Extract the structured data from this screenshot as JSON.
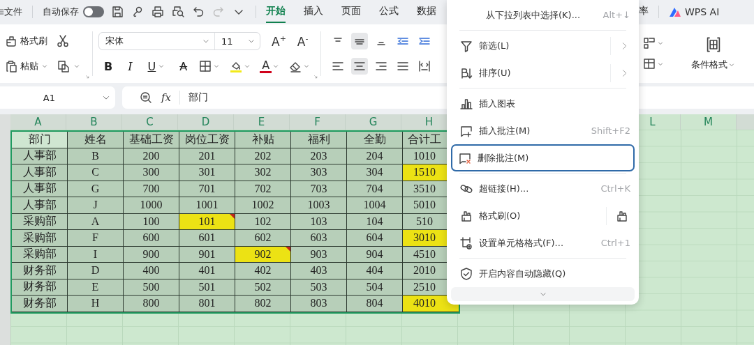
{
  "topbar": {
    "file_menu": "文件",
    "autosave": {
      "label": "自动保存",
      "on": false
    },
    "tabs": [
      {
        "label": "开始",
        "selected": true
      },
      {
        "label": "插入",
        "selected": false
      },
      {
        "label": "页面",
        "selected": false
      },
      {
        "label": "公式",
        "selected": false
      },
      {
        "label": "数据",
        "selected": false
      }
    ],
    "right_tab": "率",
    "ai_button": "WPS AI"
  },
  "ribbon": {
    "format_painter": "格式刷",
    "paste": "粘贴",
    "font_name": "宋体",
    "font_size": "11",
    "grow_font": "A$^{+}$",
    "shrink_font": "A$^{-}$",
    "format_buttons": [
      {
        "kind": "bold",
        "label": "B"
      },
      {
        "kind": "italic",
        "label": "I"
      },
      {
        "kind": "underline",
        "label": "U"
      },
      {
        "kind": "strike",
        "label": "A"
      }
    ],
    "font_color": "A",
    "conditional_format": "条件格式"
  },
  "formula_bar": {
    "cell_ref": "A1",
    "function_label": "fx",
    "value": "部门"
  },
  "sheet": {
    "columns": [
      "A",
      "B",
      "C",
      "D",
      "E",
      "F",
      "G",
      "H"
    ],
    "columns_right": [
      "L",
      "M"
    ],
    "rows": [
      [
        {
          "text": "部门",
          "highlighted": false,
          "comment": false,
          "selected": true
        },
        {
          "text": "姓名",
          "highlighted": false,
          "comment": false,
          "selected": false
        },
        {
          "text": "基础工资",
          "highlighted": false,
          "comment": false,
          "selected": false
        },
        {
          "text": "岗位工资",
          "highlighted": false,
          "comment": false,
          "selected": false
        },
        {
          "text": "补贴",
          "highlighted": false,
          "comment": false,
          "selected": false
        },
        {
          "text": "福利",
          "highlighted": false,
          "comment": false,
          "selected": false
        },
        {
          "text": "全勤",
          "highlighted": false,
          "comment": false,
          "selected": false
        },
        {
          "text": "合计工",
          "highlighted": false,
          "comment": false,
          "selected": false
        }
      ],
      [
        {
          "text": "人事部",
          "highlighted": false,
          "comment": false,
          "selected": false
        },
        {
          "text": "B",
          "highlighted": false,
          "comment": false,
          "selected": false
        },
        {
          "text": "200",
          "highlighted": false,
          "comment": false,
          "selected": false
        },
        {
          "text": "201",
          "highlighted": false,
          "comment": false,
          "selected": false
        },
        {
          "text": "202",
          "highlighted": false,
          "comment": false,
          "selected": false
        },
        {
          "text": "203",
          "highlighted": false,
          "comment": false,
          "selected": false
        },
        {
          "text": "204",
          "highlighted": false,
          "comment": false,
          "selected": false
        },
        {
          "text": "1010",
          "highlighted": false,
          "comment": false,
          "selected": false
        }
      ],
      [
        {
          "text": "人事部",
          "highlighted": false,
          "comment": false,
          "selected": false
        },
        {
          "text": "C",
          "highlighted": false,
          "comment": false,
          "selected": false
        },
        {
          "text": "300",
          "highlighted": false,
          "comment": false,
          "selected": false
        },
        {
          "text": "301",
          "highlighted": false,
          "comment": false,
          "selected": false
        },
        {
          "text": "302",
          "highlighted": false,
          "comment": false,
          "selected": false
        },
        {
          "text": "303",
          "highlighted": false,
          "comment": false,
          "selected": false
        },
        {
          "text": "304",
          "highlighted": false,
          "comment": false,
          "selected": false
        },
        {
          "text": "1510",
          "highlighted": true,
          "comment": false,
          "selected": false
        }
      ],
      [
        {
          "text": "人事部",
          "highlighted": false,
          "comment": false,
          "selected": false
        },
        {
          "text": "G",
          "highlighted": false,
          "comment": false,
          "selected": false
        },
        {
          "text": "700",
          "highlighted": false,
          "comment": false,
          "selected": false
        },
        {
          "text": "701",
          "highlighted": false,
          "comment": false,
          "selected": false
        },
        {
          "text": "702",
          "highlighted": false,
          "comment": false,
          "selected": false
        },
        {
          "text": "703",
          "highlighted": false,
          "comment": false,
          "selected": false
        },
        {
          "text": "704",
          "highlighted": false,
          "comment": false,
          "selected": false
        },
        {
          "text": "3510",
          "highlighted": false,
          "comment": false,
          "selected": false
        }
      ],
      [
        {
          "text": "人事部",
          "highlighted": false,
          "comment": false,
          "selected": false
        },
        {
          "text": "J",
          "highlighted": false,
          "comment": false,
          "selected": false
        },
        {
          "text": "1000",
          "highlighted": false,
          "comment": false,
          "selected": false
        },
        {
          "text": "1001",
          "highlighted": false,
          "comment": false,
          "selected": false
        },
        {
          "text": "1002",
          "highlighted": false,
          "comment": false,
          "selected": false
        },
        {
          "text": "1003",
          "highlighted": false,
          "comment": false,
          "selected": false
        },
        {
          "text": "1004",
          "highlighted": false,
          "comment": false,
          "selected": false
        },
        {
          "text": "5010",
          "highlighted": false,
          "comment": false,
          "selected": false
        }
      ],
      [
        {
          "text": "采购部",
          "highlighted": false,
          "comment": false,
          "selected": false
        },
        {
          "text": "A",
          "highlighted": false,
          "comment": false,
          "selected": false
        },
        {
          "text": "100",
          "highlighted": false,
          "comment": false,
          "selected": false
        },
        {
          "text": "101",
          "highlighted": true,
          "comment": true,
          "selected": false
        },
        {
          "text": "102",
          "highlighted": false,
          "comment": false,
          "selected": false
        },
        {
          "text": "103",
          "highlighted": false,
          "comment": false,
          "selected": false
        },
        {
          "text": "104",
          "highlighted": false,
          "comment": false,
          "selected": false
        },
        {
          "text": "510",
          "highlighted": false,
          "comment": false,
          "selected": false
        }
      ],
      [
        {
          "text": "采购部",
          "highlighted": false,
          "comment": false,
          "selected": false
        },
        {
          "text": "F",
          "highlighted": false,
          "comment": false,
          "selected": false
        },
        {
          "text": "600",
          "highlighted": false,
          "comment": false,
          "selected": false
        },
        {
          "text": "601",
          "highlighted": false,
          "comment": false,
          "selected": false
        },
        {
          "text": "602",
          "highlighted": false,
          "comment": false,
          "selected": false
        },
        {
          "text": "603",
          "highlighted": false,
          "comment": false,
          "selected": false
        },
        {
          "text": "604",
          "highlighted": false,
          "comment": false,
          "selected": false
        },
        {
          "text": "3010",
          "highlighted": true,
          "comment": false,
          "selected": false
        }
      ],
      [
        {
          "text": "采购部",
          "highlighted": false,
          "comment": false,
          "selected": false
        },
        {
          "text": "I",
          "highlighted": false,
          "comment": false,
          "selected": false
        },
        {
          "text": "900",
          "highlighted": false,
          "comment": false,
          "selected": false
        },
        {
          "text": "901",
          "highlighted": false,
          "comment": false,
          "selected": false
        },
        {
          "text": "902",
          "highlighted": true,
          "comment": true,
          "selected": false
        },
        {
          "text": "903",
          "highlighted": false,
          "comment": false,
          "selected": false
        },
        {
          "text": "904",
          "highlighted": false,
          "comment": false,
          "selected": false
        },
        {
          "text": "4510",
          "highlighted": false,
          "comment": false,
          "selected": false
        }
      ],
      [
        {
          "text": "财务部",
          "highlighted": false,
          "comment": false,
          "selected": false
        },
        {
          "text": "D",
          "highlighted": false,
          "comment": false,
          "selected": false
        },
        {
          "text": "400",
          "highlighted": false,
          "comment": false,
          "selected": false
        },
        {
          "text": "401",
          "highlighted": false,
          "comment": false,
          "selected": false
        },
        {
          "text": "402",
          "highlighted": false,
          "comment": false,
          "selected": false
        },
        {
          "text": "403",
          "highlighted": false,
          "comment": false,
          "selected": false
        },
        {
          "text": "404",
          "highlighted": false,
          "comment": false,
          "selected": false
        },
        {
          "text": "2010",
          "highlighted": false,
          "comment": false,
          "selected": false
        }
      ],
      [
        {
          "text": "财务部",
          "highlighted": false,
          "comment": false,
          "selected": false
        },
        {
          "text": "E",
          "highlighted": false,
          "comment": false,
          "selected": false
        },
        {
          "text": "500",
          "highlighted": false,
          "comment": false,
          "selected": false
        },
        {
          "text": "501",
          "highlighted": false,
          "comment": false,
          "selected": false
        },
        {
          "text": "502",
          "highlighted": false,
          "comment": false,
          "selected": false
        },
        {
          "text": "503",
          "highlighted": false,
          "comment": false,
          "selected": false
        },
        {
          "text": "504",
          "highlighted": false,
          "comment": false,
          "selected": false
        },
        {
          "text": "2510",
          "highlighted": false,
          "comment": false,
          "selected": false
        }
      ],
      [
        {
          "text": "财务部",
          "highlighted": false,
          "comment": false,
          "selected": false
        },
        {
          "text": "H",
          "highlighted": false,
          "comment": false,
          "selected": false
        },
        {
          "text": "800",
          "highlighted": false,
          "comment": false,
          "selected": false
        },
        {
          "text": "801",
          "highlighted": false,
          "comment": false,
          "selected": false
        },
        {
          "text": "802",
          "highlighted": false,
          "comment": false,
          "selected": false
        },
        {
          "text": "803",
          "highlighted": false,
          "comment": false,
          "selected": false
        },
        {
          "text": "804",
          "highlighted": false,
          "comment": false,
          "selected": false
        },
        {
          "text": "4010",
          "highlighted": true,
          "comment": false,
          "selected": false
        }
      ]
    ]
  },
  "context_menu": {
    "items": [
      {
        "kind": "action",
        "label": "从下拉列表中选择(K)...",
        "shortcut": "Alt+↓",
        "selected": false
      },
      {
        "kind": "divider"
      },
      {
        "kind": "submenu",
        "label": "筛选(L)",
        "selected": false
      },
      {
        "kind": "submenu",
        "label": "排序(U)",
        "selected": false
      },
      {
        "kind": "divider"
      },
      {
        "kind": "action",
        "label": "插入图表",
        "selected": false
      },
      {
        "kind": "action",
        "label": "插入批注(M)",
        "shortcut": "Shift+F2",
        "selected": false
      },
      {
        "kind": "action",
        "label": "删除批注(M)",
        "selected": true
      },
      {
        "kind": "divider"
      },
      {
        "kind": "action",
        "label": "超链接(H)...",
        "shortcut": "Ctrl+K",
        "selected": false
      },
      {
        "kind": "tool",
        "label": "格式刷(O)",
        "selected": false
      },
      {
        "kind": "action",
        "label": "设置单元格格式(F)...",
        "shortcut": "Ctrl+1",
        "selected": false
      },
      {
        "kind": "divider"
      },
      {
        "kind": "action",
        "label": "开启内容自动隐藏(Q)",
        "selected": false
      }
    ]
  }
}
